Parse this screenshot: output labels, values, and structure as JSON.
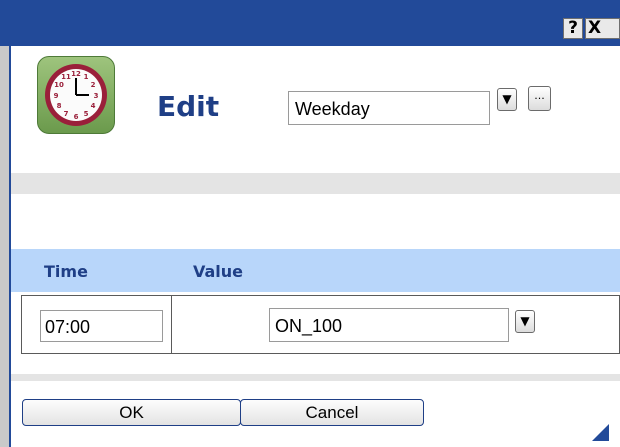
{
  "titlebar": {
    "help_label": "?",
    "close_label": "X"
  },
  "header": {
    "title": "Edit",
    "schedule_value": "Weekday",
    "dropdown_glyph": "▼",
    "more_label": "..."
  },
  "table": {
    "headers": {
      "time": "Time",
      "value": "Value"
    },
    "rows": [
      {
        "time": "07:00",
        "value": "ON_100"
      }
    ]
  },
  "buttons": {
    "ok": "OK",
    "cancel": "Cancel"
  },
  "icons": {
    "clock": "clock-icon"
  },
  "colors": {
    "titlebar": "#224a99",
    "header_text": "#1f3f86",
    "table_header": "#b8d6fa"
  }
}
